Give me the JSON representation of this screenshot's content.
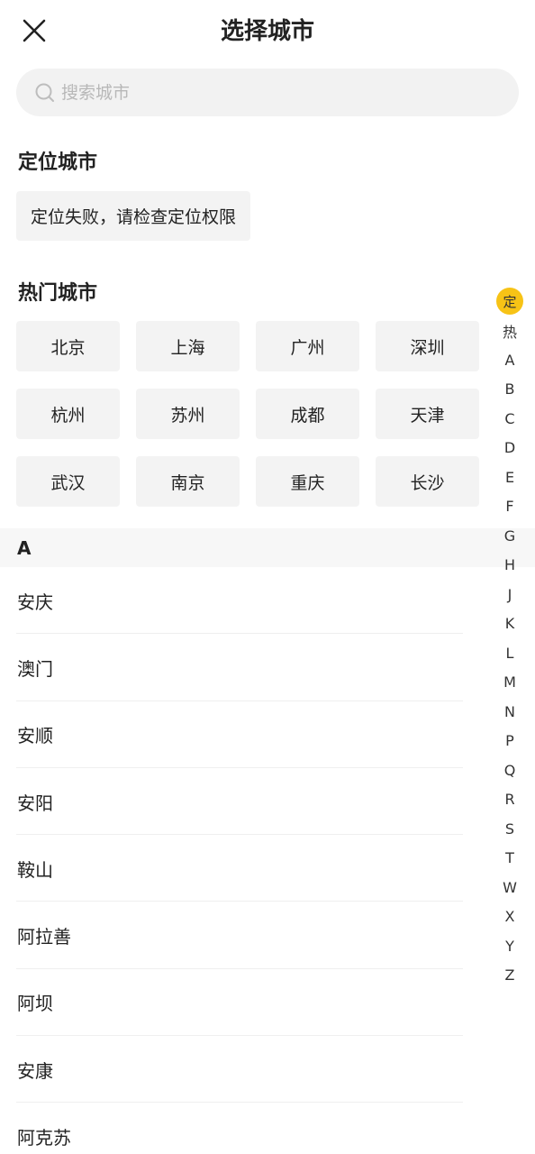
{
  "header": {
    "title": "选择城市",
    "close_icon": "close-icon"
  },
  "search": {
    "placeholder": "搜索城市",
    "value": ""
  },
  "location": {
    "section_title": "定位城市",
    "status_text": "定位失败，请检查定位权限"
  },
  "hot": {
    "section_title": "热门城市",
    "cities": [
      "北京",
      "上海",
      "广州",
      "深圳",
      "杭州",
      "苏州",
      "成都",
      "天津",
      "武汉",
      "南京",
      "重庆",
      "长沙"
    ]
  },
  "list": {
    "current_letter": "A",
    "cities": [
      "安庆",
      "澳门",
      "安顺",
      "安阳",
      "鞍山",
      "阿拉善",
      "阿坝",
      "安康",
      "阿克苏"
    ]
  },
  "alpha_index": {
    "active": "定",
    "items": [
      "定",
      "热",
      "A",
      "B",
      "C",
      "D",
      "E",
      "F",
      "G",
      "H",
      "J",
      "K",
      "L",
      "M",
      "N",
      "P",
      "Q",
      "R",
      "S",
      "T",
      "W",
      "X",
      "Y",
      "Z"
    ]
  },
  "colors": {
    "accent": "#f7c316",
    "chip_bg": "#f3f3f3",
    "placeholder": "#b8b8b8"
  }
}
